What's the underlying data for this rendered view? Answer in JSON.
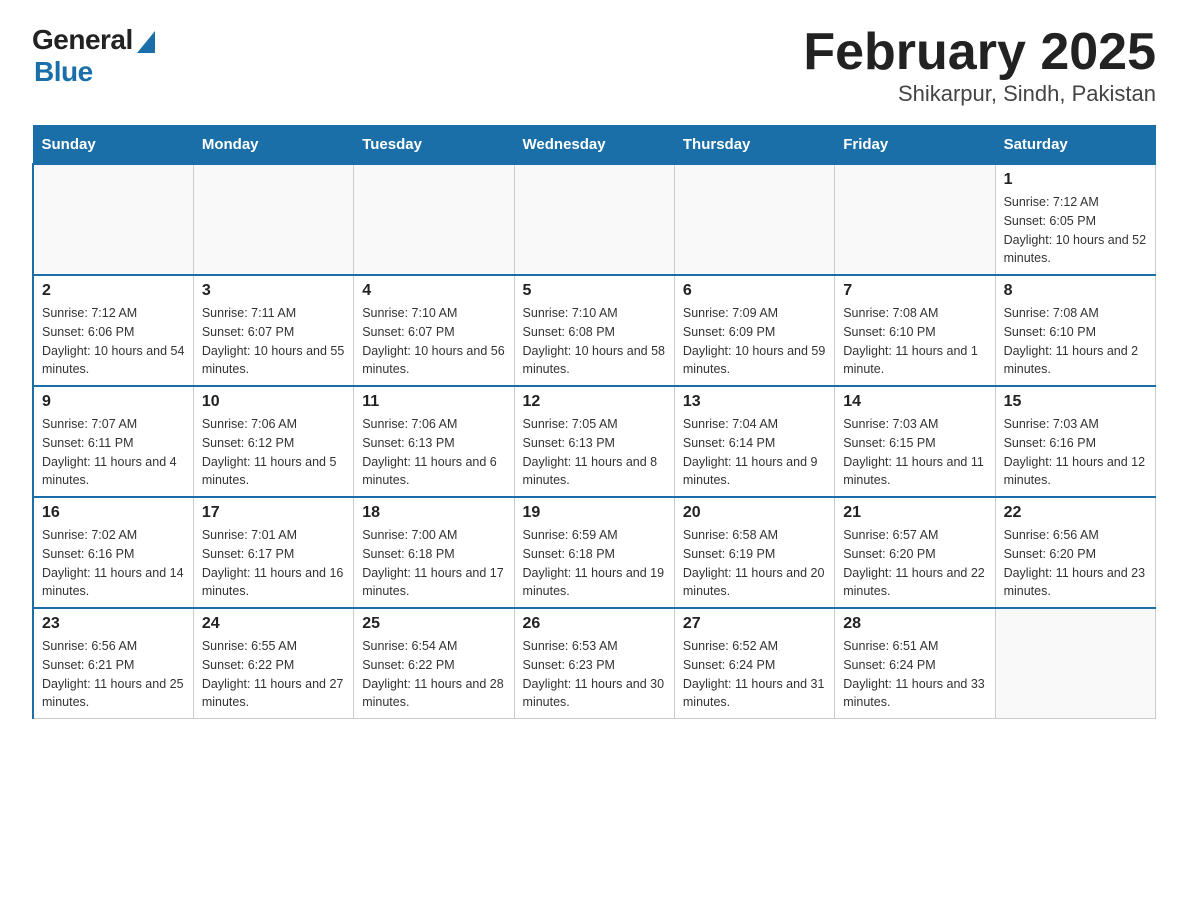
{
  "header": {
    "logo_general": "General",
    "logo_blue": "Blue",
    "title": "February 2025",
    "subtitle": "Shikarpur, Sindh, Pakistan"
  },
  "calendar": {
    "days_of_week": [
      "Sunday",
      "Monday",
      "Tuesday",
      "Wednesday",
      "Thursday",
      "Friday",
      "Saturday"
    ],
    "weeks": [
      [
        {
          "day": "",
          "info": ""
        },
        {
          "day": "",
          "info": ""
        },
        {
          "day": "",
          "info": ""
        },
        {
          "day": "",
          "info": ""
        },
        {
          "day": "",
          "info": ""
        },
        {
          "day": "",
          "info": ""
        },
        {
          "day": "1",
          "info": "Sunrise: 7:12 AM\nSunset: 6:05 PM\nDaylight: 10 hours and 52 minutes."
        }
      ],
      [
        {
          "day": "2",
          "info": "Sunrise: 7:12 AM\nSunset: 6:06 PM\nDaylight: 10 hours and 54 minutes."
        },
        {
          "day": "3",
          "info": "Sunrise: 7:11 AM\nSunset: 6:07 PM\nDaylight: 10 hours and 55 minutes."
        },
        {
          "day": "4",
          "info": "Sunrise: 7:10 AM\nSunset: 6:07 PM\nDaylight: 10 hours and 56 minutes."
        },
        {
          "day": "5",
          "info": "Sunrise: 7:10 AM\nSunset: 6:08 PM\nDaylight: 10 hours and 58 minutes."
        },
        {
          "day": "6",
          "info": "Sunrise: 7:09 AM\nSunset: 6:09 PM\nDaylight: 10 hours and 59 minutes."
        },
        {
          "day": "7",
          "info": "Sunrise: 7:08 AM\nSunset: 6:10 PM\nDaylight: 11 hours and 1 minute."
        },
        {
          "day": "8",
          "info": "Sunrise: 7:08 AM\nSunset: 6:10 PM\nDaylight: 11 hours and 2 minutes."
        }
      ],
      [
        {
          "day": "9",
          "info": "Sunrise: 7:07 AM\nSunset: 6:11 PM\nDaylight: 11 hours and 4 minutes."
        },
        {
          "day": "10",
          "info": "Sunrise: 7:06 AM\nSunset: 6:12 PM\nDaylight: 11 hours and 5 minutes."
        },
        {
          "day": "11",
          "info": "Sunrise: 7:06 AM\nSunset: 6:13 PM\nDaylight: 11 hours and 6 minutes."
        },
        {
          "day": "12",
          "info": "Sunrise: 7:05 AM\nSunset: 6:13 PM\nDaylight: 11 hours and 8 minutes."
        },
        {
          "day": "13",
          "info": "Sunrise: 7:04 AM\nSunset: 6:14 PM\nDaylight: 11 hours and 9 minutes."
        },
        {
          "day": "14",
          "info": "Sunrise: 7:03 AM\nSunset: 6:15 PM\nDaylight: 11 hours and 11 minutes."
        },
        {
          "day": "15",
          "info": "Sunrise: 7:03 AM\nSunset: 6:16 PM\nDaylight: 11 hours and 12 minutes."
        }
      ],
      [
        {
          "day": "16",
          "info": "Sunrise: 7:02 AM\nSunset: 6:16 PM\nDaylight: 11 hours and 14 minutes."
        },
        {
          "day": "17",
          "info": "Sunrise: 7:01 AM\nSunset: 6:17 PM\nDaylight: 11 hours and 16 minutes."
        },
        {
          "day": "18",
          "info": "Sunrise: 7:00 AM\nSunset: 6:18 PM\nDaylight: 11 hours and 17 minutes."
        },
        {
          "day": "19",
          "info": "Sunrise: 6:59 AM\nSunset: 6:18 PM\nDaylight: 11 hours and 19 minutes."
        },
        {
          "day": "20",
          "info": "Sunrise: 6:58 AM\nSunset: 6:19 PM\nDaylight: 11 hours and 20 minutes."
        },
        {
          "day": "21",
          "info": "Sunrise: 6:57 AM\nSunset: 6:20 PM\nDaylight: 11 hours and 22 minutes."
        },
        {
          "day": "22",
          "info": "Sunrise: 6:56 AM\nSunset: 6:20 PM\nDaylight: 11 hours and 23 minutes."
        }
      ],
      [
        {
          "day": "23",
          "info": "Sunrise: 6:56 AM\nSunset: 6:21 PM\nDaylight: 11 hours and 25 minutes."
        },
        {
          "day": "24",
          "info": "Sunrise: 6:55 AM\nSunset: 6:22 PM\nDaylight: 11 hours and 27 minutes."
        },
        {
          "day": "25",
          "info": "Sunrise: 6:54 AM\nSunset: 6:22 PM\nDaylight: 11 hours and 28 minutes."
        },
        {
          "day": "26",
          "info": "Sunrise: 6:53 AM\nSunset: 6:23 PM\nDaylight: 11 hours and 30 minutes."
        },
        {
          "day": "27",
          "info": "Sunrise: 6:52 AM\nSunset: 6:24 PM\nDaylight: 11 hours and 31 minutes."
        },
        {
          "day": "28",
          "info": "Sunrise: 6:51 AM\nSunset: 6:24 PM\nDaylight: 11 hours and 33 minutes."
        },
        {
          "day": "",
          "info": ""
        }
      ]
    ]
  }
}
